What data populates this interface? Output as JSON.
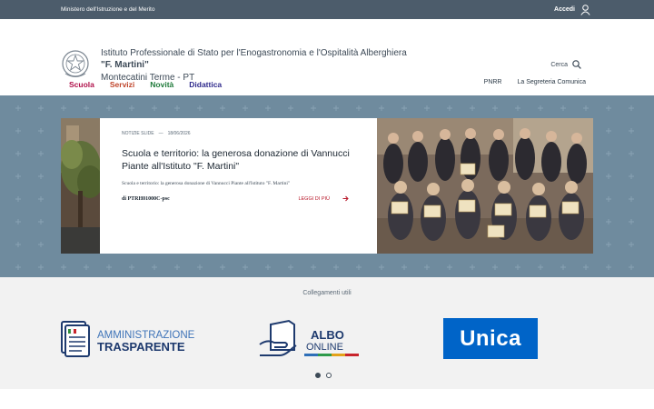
{
  "topbar": {
    "ministry": "Ministero dell'Istruzione e del Merito",
    "login_label": "Accedi"
  },
  "header": {
    "school_line1": "Istituto Professionale di Stato per l'Enogastronomia e l'Ospitalità Alberghiera",
    "school_name": "\"F. Martini\"",
    "school_location": "Montecatini Terme - PT",
    "search_label": "Cerca"
  },
  "nav": {
    "items": [
      {
        "label": "Scuola",
        "color": "#b0104a"
      },
      {
        "label": "Servizi",
        "color": "#c0462c"
      },
      {
        "label": "Novità",
        "color": "#1f7a3a"
      },
      {
        "label": "Didattica",
        "color": "#2f2a8c"
      }
    ],
    "right": [
      {
        "label": "PNRR"
      },
      {
        "label": "La Segreteria Comunica"
      }
    ]
  },
  "slide": {
    "category": "NOTIZIE SLIDE",
    "separator": "—",
    "date": "18/06/2026",
    "headline": "Scuola e territorio: la generosa donazione di Vannucci Piante all'Istituto \"F. Martini\"",
    "excerpt": "Scuola e territorio: la generosa donazione di Vannucci Piante all'Istituto \"F. Martini\"",
    "author": "di PTRH01000C-psc",
    "read_more": "LEGGI DI PIÙ",
    "slide_count": 3,
    "active_slide": 1
  },
  "links": {
    "title": "Collegamenti utili",
    "amm_line1": "AMMINISTRAZIONE",
    "amm_line2": "TRASPARENTE",
    "albo_line1": "ALBO",
    "albo_line2": "ONLINE",
    "unica": "Unica",
    "page_count": 2,
    "active_page": 1
  },
  "colors": {
    "topbar": "#4c5c6b",
    "hero": "#6f8b9e",
    "accent_red": "#b8182a",
    "unica_blue": "#0064c8"
  }
}
